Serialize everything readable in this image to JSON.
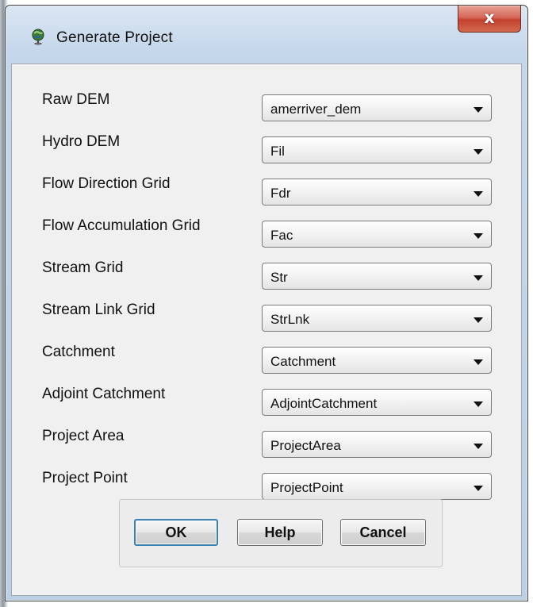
{
  "window": {
    "title": "Generate Project",
    "close_label": "x"
  },
  "fields": [
    {
      "label": "Raw DEM",
      "value": "amerriver_dem"
    },
    {
      "label": "Hydro DEM",
      "value": "Fil"
    },
    {
      "label": "Flow Direction Grid",
      "value": "Fdr"
    },
    {
      "label": "Flow Accumulation Grid",
      "value": "Fac"
    },
    {
      "label": "Stream Grid",
      "value": "Str"
    },
    {
      "label": "Stream Link Grid",
      "value": "StrLnk"
    },
    {
      "label": "Catchment",
      "value": "Catchment"
    },
    {
      "label": "Adjoint Catchment",
      "value": "AdjointCatchment"
    },
    {
      "label": "Project Area",
      "value": "ProjectArea"
    },
    {
      "label": "Project Point",
      "value": "ProjectPoint"
    }
  ],
  "buttons": {
    "ok": "OK",
    "help": "Help",
    "cancel": "Cancel"
  },
  "icons": {
    "app": "globe-pin-icon",
    "close": "close-icon",
    "dropdown": "dropdown-arrow-icon"
  },
  "colors": {
    "close_button": "#c2412f",
    "frame": "#bcd0e5",
    "client": "#f0f0f0",
    "default_button_border": "#3c7fb1"
  }
}
